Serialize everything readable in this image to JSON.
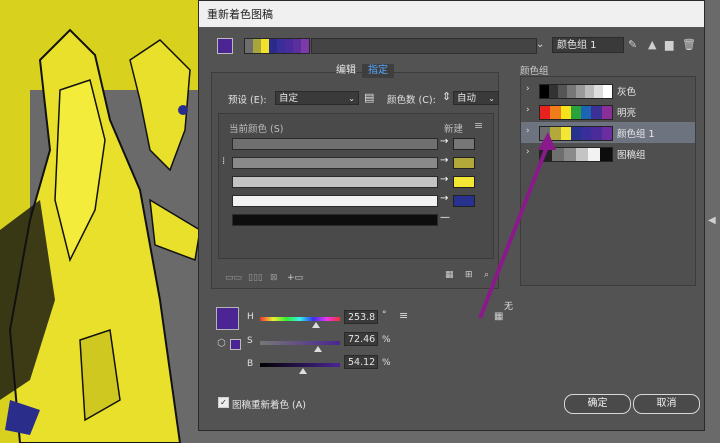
{
  "window": {
    "title": "重新着色图稿"
  },
  "colors": {
    "art_yellow": "#d8d21e",
    "art_gray": "#6a6a6a",
    "dialog_bg": "#535353",
    "accent_purple": "#4b2593",
    "arrow_purple": "#8a1a8a"
  },
  "top": {
    "group_name": "颜色组 1",
    "icons": [
      "eyedropper-icon",
      "new-group-icon",
      "folder-icon",
      "trash-icon"
    ],
    "bar_colors": [
      "#6d6d6d",
      "#a8a63a",
      "#f1e12a",
      "#2a2a8a",
      "#3a2f9a",
      "#4b2a9a",
      "#5a2e9c",
      "#7b3aa8"
    ]
  },
  "tabs": {
    "edit": "编辑",
    "assign": "指定"
  },
  "preset": {
    "label": "预设 (E):",
    "value": "自定"
  },
  "color_count": {
    "label": "颜色数 (C):",
    "value": "自动"
  },
  "table": {
    "current_label": "当前颜色 (S)",
    "new_label": "新建",
    "rows": [
      {
        "current": "#6f6f6f",
        "new": "#777777"
      },
      {
        "current": "#8a8a8a",
        "new": "#b3a93a"
      },
      {
        "current": "#c4c4c4",
        "new": "#f3e733"
      },
      {
        "current": "#f2f2f2",
        "new": "#27328e"
      },
      {
        "current": "#0d0d0d",
        "new": ""
      }
    ]
  },
  "hsb": {
    "h_label": "H",
    "h_value": "253.8",
    "h_unit": "°",
    "h_level": 0.7,
    "s_label": "S",
    "s_value": "72.46",
    "s_unit": "%",
    "s_level": 0.72,
    "b_label": "B",
    "b_value": "54.12",
    "b_unit": "%",
    "b_level": 0.54
  },
  "side_label": "无",
  "groups_label": "颜色组",
  "groups": [
    {
      "name": "灰色",
      "colors": [
        "#000000",
        "#333333",
        "#555555",
        "#777777",
        "#999999",
        "#bbbbbb",
        "#dddddd",
        "#ffffff"
      ],
      "selected": false
    },
    {
      "name": "明亮",
      "colors": [
        "#e8231f",
        "#f07d19",
        "#f6e31b",
        "#2aa43a",
        "#1b65b3",
        "#3c2f95",
        "#8b2f98"
      ],
      "selected": false
    },
    {
      "name": "颜色组 1",
      "colors": [
        "#6d6d6d",
        "#b3a93a",
        "#f3e733",
        "#27328e",
        "#3a2f9a",
        "#4b2a9a",
        "#6a2ea0"
      ],
      "selected": true
    },
    {
      "name": "图稿组",
      "colors": [
        "#222222",
        "#6f6f6f",
        "#8a8a8a",
        "#c4c4c4",
        "#f2f2f2",
        "#0d0d0d"
      ],
      "selected": false
    }
  ],
  "footer": {
    "recolor_label": "图稿重新着色 (A)",
    "ok": "确定",
    "cancel": "取消"
  }
}
